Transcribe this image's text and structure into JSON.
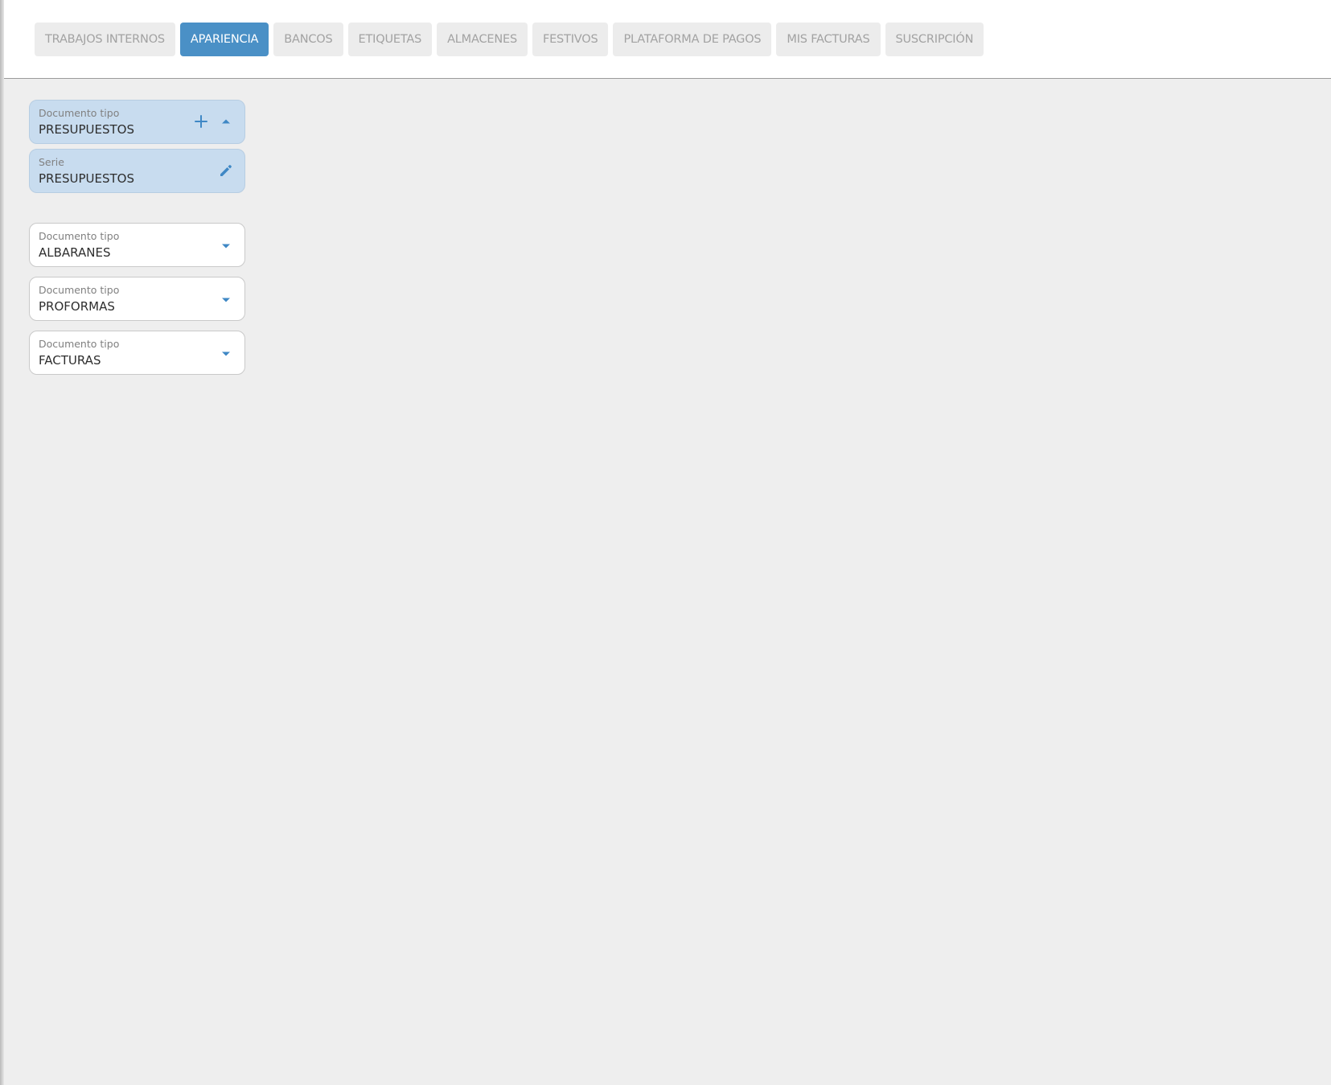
{
  "tabs": [
    {
      "label": "TRABAJOS INTERNOS",
      "active": false
    },
    {
      "label": "APARIENCIA",
      "active": true
    },
    {
      "label": "BANCOS",
      "active": false
    },
    {
      "label": "ETIQUETAS",
      "active": false
    },
    {
      "label": "ALMACENES",
      "active": false
    },
    {
      "label": "FESTIVOS",
      "active": false
    },
    {
      "label": "PLATAFORMA DE PAGOS",
      "active": false
    },
    {
      "label": "MIS FACTURAS",
      "active": false
    },
    {
      "label": "SUSCRIPCIÓN",
      "active": false
    }
  ],
  "expanded_group": {
    "doc_type": {
      "label": "Documento tipo",
      "value": "PRESUPUESTOS",
      "icons": [
        "plus-icon",
        "chevron-up-icon"
      ]
    },
    "serie": {
      "label": "Serie",
      "value": "PRESUPUESTOS",
      "icons": [
        "pencil-icon"
      ]
    }
  },
  "collapsed_docs": [
    {
      "label": "Documento tipo",
      "value": "ALBARANES",
      "icon": "chevron-down-icon"
    },
    {
      "label": "Documento tipo",
      "value": "PROFORMAS",
      "icon": "chevron-down-icon"
    },
    {
      "label": "Documento tipo",
      "value": "FACTURAS",
      "icon": "chevron-down-icon"
    }
  ],
  "colors": {
    "accent": "#4a90c6",
    "expanded_bg": "#c8dcef",
    "icon": "#3f88c5",
    "background": "#eeeeee"
  }
}
